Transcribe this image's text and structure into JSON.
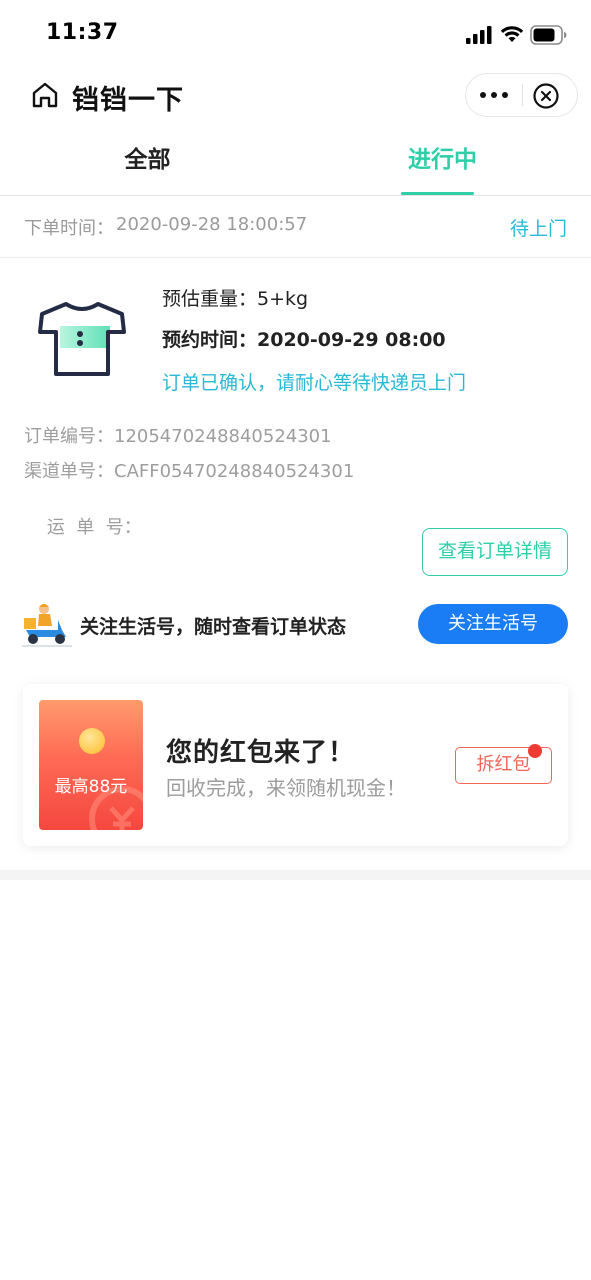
{
  "status_bar": {
    "time": "11:37"
  },
  "nav": {
    "title": "铛铛一下"
  },
  "tabs": [
    {
      "label": "全部",
      "active": false
    },
    {
      "label": "进行中",
      "active": true
    }
  ],
  "order": {
    "time_label": "下单时间：",
    "time_value": "2020-09-28 18:00:57",
    "status": "待上门",
    "weight_label": "预估重量：",
    "weight_value": "5+kg",
    "appoint_label": "预约时间：",
    "appoint_value": "2020-09-29 08:00",
    "confirm_text": "订单已确认，请耐心等待快递员上门",
    "order_no_label": "订单编号：",
    "order_no_value": "120547024884052430​1",
    "channel_no_label": "渠道单号：",
    "channel_no_value": "CAFF05470248840524301",
    "waybill_label": "运  单  号：",
    "waybill_value": "",
    "detail_button": "查看订单详情"
  },
  "follow": {
    "text": "关注生活号，随时查看订单状态",
    "button": "关注生活号"
  },
  "red_packet": {
    "badge_text": "最高88元",
    "title": "您的红包来了！",
    "subtitle": "回收完成，来领随机现金！",
    "open_button": "拆红包"
  },
  "colors": {
    "accent_green": "#2ecfa8",
    "accent_cyan": "#29b8d8",
    "primary_blue": "#1a7df5",
    "red": "#f2665a"
  }
}
